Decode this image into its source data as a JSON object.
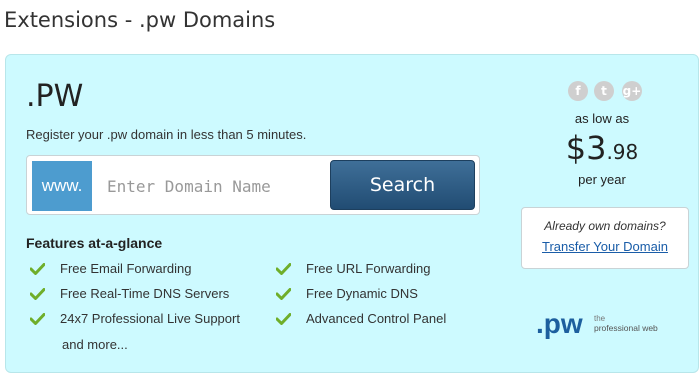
{
  "page": {
    "title": "Extensions - .pw Domains"
  },
  "panel": {
    "tld": ".PW",
    "subtitle": "Register your .pw domain in less than 5 minutes.",
    "search": {
      "prefix": "www.",
      "placeholder": "Enter Domain Name",
      "value": "",
      "button_label": "Search"
    },
    "features": {
      "title": "Features at-a-glance",
      "items": [
        "Free Email Forwarding",
        "Free URL Forwarding",
        "Free Real-Time DNS Servers",
        "Free Dynamic DNS",
        "24x7 Professional Live Support",
        "Advanced Control Panel"
      ],
      "more": "and more..."
    },
    "social": [
      {
        "icon": "facebook-icon",
        "glyph": "f"
      },
      {
        "icon": "twitter-icon",
        "glyph": "t"
      },
      {
        "icon": "google-plus-icon",
        "glyph": "g+"
      }
    ],
    "pricing": {
      "pre": "as low as",
      "main": "$3",
      "cents": ".98",
      "post": "per year"
    },
    "own": {
      "question": "Already own domains?",
      "link": "Transfer Your Domain"
    },
    "logo": {
      "text": ".pw",
      "tagline_1": "the",
      "tagline_2": "professional web"
    }
  },
  "colors": {
    "panel_bg": "#cdfaff",
    "www_bg": "#4d9ccf",
    "button_bg": "#2c5a82",
    "check": "#6fae2a",
    "link": "#1a5da8",
    "logo": "#1d5f9e"
  }
}
